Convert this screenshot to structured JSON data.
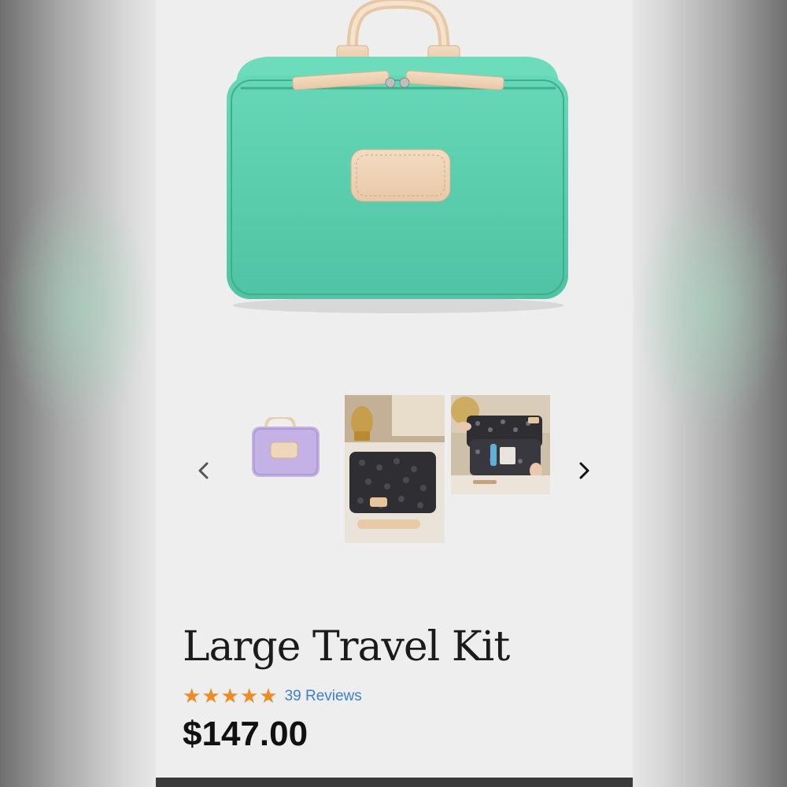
{
  "product": {
    "title": "Large Travel Kit",
    "rating": 5,
    "rating_max": 5,
    "reviews_label": "39 Reviews",
    "price": "$147.00",
    "main_color": "#5fd3b1"
  },
  "gallery": {
    "thumbnails": [
      {
        "name": "lavender-kit"
      },
      {
        "name": "leopard-kit-on-vanity"
      },
      {
        "name": "open-kit-in-use"
      }
    ],
    "prev_icon": "chevron-left-icon",
    "next_icon": "chevron-right-icon"
  },
  "colors": {
    "star": "#f08a24",
    "link": "#3d7fd0",
    "panel": "#efeeef"
  }
}
